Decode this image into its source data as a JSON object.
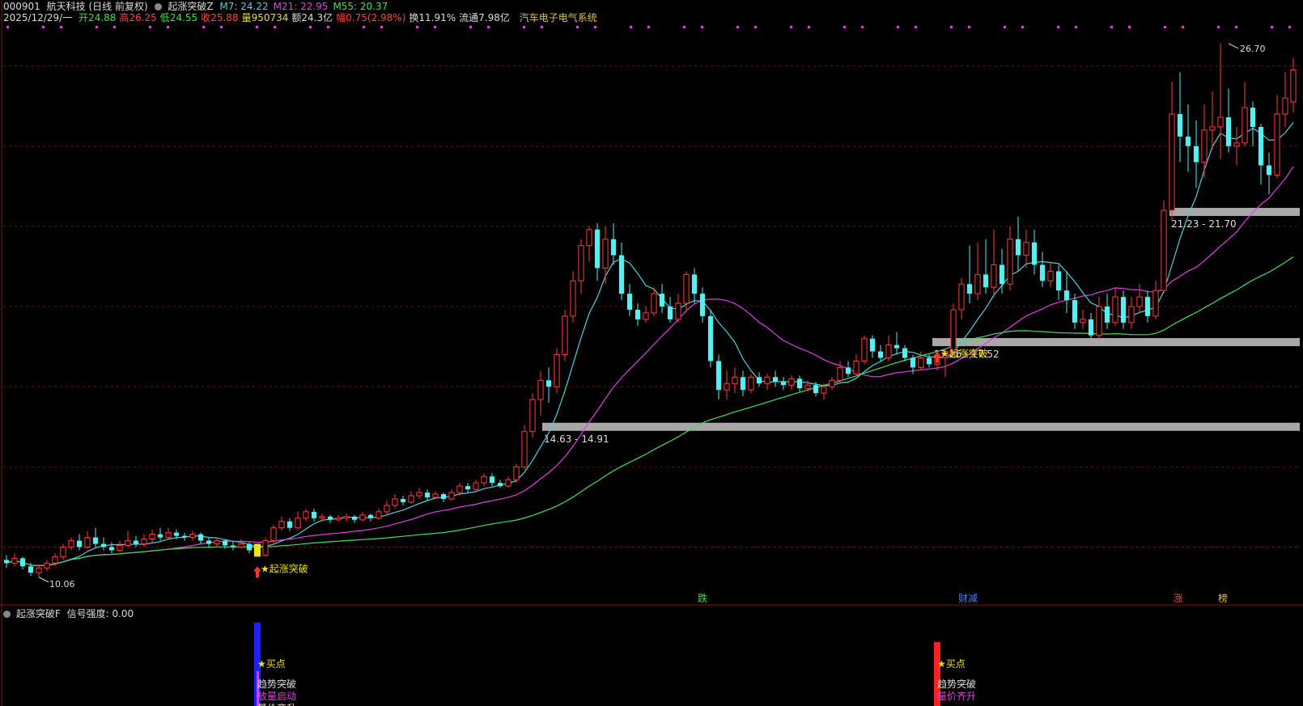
{
  "header": {
    "code": "000901",
    "name": "航天科技",
    "period": "(日线 前复权)",
    "indicator": "起涨突破Z",
    "ma": [
      {
        "label": "M7:",
        "value": "24.22",
        "color": "#4fd0e0"
      },
      {
        "label": "M21:",
        "value": "22.95",
        "color": "#e040e0"
      },
      {
        "label": "M55:",
        "value": "20.37",
        "color": "#40e060"
      }
    ],
    "date": "2025/12/29/一",
    "fields": [
      {
        "label": "开",
        "value": "24.88",
        "color": "#40e040"
      },
      {
        "label": "高",
        "value": "26.25",
        "color": "#ff4040"
      },
      {
        "label": "低",
        "value": "24.55",
        "color": "#40e040"
      },
      {
        "label": "收",
        "value": "25.88",
        "color": "#ff4040"
      },
      {
        "label": "量",
        "value": "950734",
        "color": "#e0e040"
      },
      {
        "label": "额",
        "value": "24.3亿",
        "color": "#dddddd"
      },
      {
        "label": "幅",
        "value": "0.75(2.98%)",
        "color": "#ff4040"
      },
      {
        "label": "换",
        "value": "11.91%",
        "color": "#dddddd"
      },
      {
        "label": "流通",
        "value": "7.98亿",
        "color": "#dddddd"
      }
    ],
    "sector": "汽车电子电气系统"
  },
  "colors": {
    "up": "#ff3d3d",
    "down": "#52f0f0",
    "ma7": "#4fd0e0",
    "ma21": "#e040e0",
    "ma55": "#40e060",
    "grid": "#6a1010",
    "zone": "#a8a8a8",
    "signal": "#f0e020"
  },
  "labels": {
    "high_price": "26.70",
    "low_price": "10.06",
    "breakout": "★起涨突破"
  },
  "zones": [
    {
      "range": "14.63 - 14.91",
      "price": 14.75
    },
    {
      "range": "17.26 - 17.52",
      "price": 17.39
    },
    {
      "range": "21.23 - 21.70",
      "price": 21.45
    }
  ],
  "events": [
    "跌",
    "财减",
    "涨",
    "榜"
  ],
  "sub": {
    "title": "起涨突破F",
    "strength_label": "信号强度:",
    "strength_value": "0.00",
    "signal1": {
      "buy": "★买点",
      "lines": [
        "趋势突破",
        "放量启动",
        "量价齐升"
      ]
    },
    "signal2": {
      "buy": "★买点",
      "lines": [
        "趋势突破",
        "量价齐升"
      ]
    }
  },
  "chart_data": {
    "type": "candlestick",
    "candles": [
      [
        10.6,
        10.5,
        10.75,
        10.35
      ],
      [
        10.5,
        10.65,
        10.8,
        10.4
      ],
      [
        10.65,
        10.4,
        10.7,
        10.3
      ],
      [
        10.4,
        10.2,
        10.5,
        10.1
      ],
      [
        10.2,
        10.35,
        10.45,
        10.06
      ],
      [
        10.35,
        10.5,
        10.6,
        10.25
      ],
      [
        10.5,
        10.7,
        10.8,
        10.4
      ],
      [
        10.7,
        11.0,
        11.1,
        10.6
      ],
      [
        11.0,
        11.2,
        11.3,
        10.9
      ],
      [
        11.2,
        11.0,
        11.4,
        10.9
      ],
      [
        11.0,
        11.3,
        11.5,
        10.95
      ],
      [
        11.3,
        11.1,
        11.6,
        11.0
      ],
      [
        11.1,
        11.0,
        11.3,
        10.9
      ],
      [
        11.0,
        10.9,
        11.15,
        10.8
      ],
      [
        10.9,
        11.05,
        11.2,
        10.85
      ],
      [
        11.05,
        11.2,
        11.5,
        11.0
      ],
      [
        11.2,
        11.1,
        11.35,
        11.0
      ],
      [
        11.1,
        11.25,
        11.4,
        11.0
      ],
      [
        11.25,
        11.4,
        11.55,
        11.1
      ],
      [
        11.4,
        11.3,
        11.6,
        11.2
      ],
      [
        11.3,
        11.45,
        11.6,
        11.25
      ],
      [
        11.45,
        11.35,
        11.55,
        11.25
      ],
      [
        11.35,
        11.3,
        11.45,
        11.2
      ],
      [
        11.3,
        11.4,
        11.5,
        11.2
      ],
      [
        11.4,
        11.2,
        11.45,
        11.1
      ],
      [
        11.2,
        11.1,
        11.3,
        11.0
      ],
      [
        11.1,
        11.2,
        11.3,
        11.0
      ],
      [
        11.2,
        11.05,
        11.25,
        10.95
      ],
      [
        11.05,
        11.0,
        11.2,
        10.9
      ],
      [
        11.0,
        11.1,
        11.25,
        10.95
      ],
      [
        11.1,
        10.9,
        11.15,
        10.8
      ],
      [
        10.9,
        10.75,
        11.0,
        10.7
      ],
      [
        10.75,
        11.2,
        11.3,
        10.7
      ],
      [
        11.2,
        11.6,
        11.7,
        11.1
      ],
      [
        11.6,
        11.8,
        11.95,
        11.5
      ],
      [
        11.8,
        11.6,
        11.9,
        11.5
      ],
      [
        11.6,
        11.9,
        12.1,
        11.55
      ],
      [
        11.9,
        12.1,
        12.2,
        11.8
      ],
      [
        12.1,
        11.9,
        12.2,
        11.8
      ],
      [
        11.9,
        11.95,
        12.05,
        11.8
      ],
      [
        11.95,
        11.85,
        12.0,
        11.75
      ],
      [
        11.85,
        11.9,
        12.0,
        11.8
      ],
      [
        11.9,
        11.95,
        12.05,
        11.8
      ],
      [
        11.95,
        11.85,
        12.0,
        11.75
      ],
      [
        11.85,
        12.0,
        12.1,
        11.8
      ],
      [
        12.0,
        11.9,
        12.05,
        11.8
      ],
      [
        11.9,
        12.1,
        12.2,
        11.85
      ],
      [
        12.1,
        12.3,
        12.45,
        12.0
      ],
      [
        12.3,
        12.5,
        12.65,
        12.2
      ],
      [
        12.5,
        12.4,
        12.6,
        12.3
      ],
      [
        12.4,
        12.6,
        12.75,
        12.35
      ],
      [
        12.6,
        12.7,
        12.85,
        12.5
      ],
      [
        12.7,
        12.55,
        12.8,
        12.45
      ],
      [
        12.55,
        12.65,
        12.75,
        12.5
      ],
      [
        12.65,
        12.5,
        12.7,
        12.4
      ],
      [
        12.5,
        12.7,
        12.8,
        12.45
      ],
      [
        12.7,
        12.9,
        13.0,
        12.6
      ],
      [
        12.9,
        12.8,
        13.0,
        12.7
      ],
      [
        12.8,
        13.0,
        13.1,
        12.7
      ],
      [
        13.0,
        13.2,
        13.3,
        12.9
      ],
      [
        13.2,
        13.0,
        13.3,
        12.9
      ],
      [
        13.0,
        12.9,
        13.1,
        12.85
      ],
      [
        12.9,
        13.1,
        13.2,
        12.85
      ],
      [
        13.1,
        13.5,
        13.6,
        13.0
      ],
      [
        13.5,
        14.6,
        14.8,
        13.4
      ],
      [
        14.6,
        15.6,
        15.8,
        14.4
      ],
      [
        15.6,
        16.2,
        16.5,
        15.1
      ],
      [
        16.2,
        16.0,
        16.6,
        15.5
      ],
      [
        16.0,
        17.0,
        17.2,
        15.8
      ],
      [
        17.0,
        18.2,
        18.4,
        16.8
      ],
      [
        18.2,
        19.3,
        19.6,
        18.0
      ],
      [
        19.3,
        20.4,
        20.6,
        18.9
      ],
      [
        20.4,
        20.9,
        21.0,
        19.9
      ],
      [
        20.9,
        19.7,
        21.1,
        19.3
      ],
      [
        19.7,
        20.6,
        21.0,
        19.2
      ],
      [
        20.6,
        20.1,
        21.1,
        19.8
      ],
      [
        20.1,
        18.9,
        20.5,
        18.7
      ],
      [
        18.9,
        18.4,
        19.2,
        18.2
      ],
      [
        18.4,
        18.1,
        18.6,
        17.9
      ],
      [
        18.1,
        18.3,
        18.5,
        18.0
      ],
      [
        18.3,
        18.9,
        19.1,
        18.2
      ],
      [
        18.9,
        18.5,
        19.2,
        18.3
      ],
      [
        18.5,
        18.1,
        18.8,
        18.0
      ],
      [
        18.1,
        18.6,
        18.9,
        18.0
      ],
      [
        18.6,
        19.5,
        19.6,
        18.3
      ],
      [
        19.5,
        18.9,
        19.7,
        18.6
      ],
      [
        18.9,
        18.2,
        19.1,
        18.0
      ],
      [
        18.2,
        16.8,
        18.4,
        16.6
      ],
      [
        16.8,
        15.9,
        17.0,
        15.6
      ],
      [
        15.9,
        16.1,
        16.5,
        15.6
      ],
      [
        16.1,
        16.3,
        16.6,
        15.8
      ],
      [
        16.3,
        15.9,
        16.5,
        15.7
      ],
      [
        15.9,
        16.3,
        16.4,
        15.8
      ],
      [
        16.3,
        16.1,
        16.45,
        16.0
      ],
      [
        16.1,
        16.3,
        16.4,
        15.9
      ],
      [
        16.3,
        16.15,
        16.5,
        16.0
      ],
      [
        16.15,
        16.05,
        16.3,
        15.9
      ],
      [
        16.05,
        16.25,
        16.35,
        15.9
      ],
      [
        16.25,
        15.95,
        16.35,
        15.85
      ],
      [
        15.95,
        16.05,
        16.2,
        15.85
      ],
      [
        16.05,
        15.8,
        16.15,
        15.7
      ],
      [
        15.8,
        16.0,
        16.1,
        15.6
      ],
      [
        16.0,
        16.2,
        16.3,
        15.9
      ],
      [
        16.2,
        16.6,
        16.8,
        16.1
      ],
      [
        16.6,
        16.4,
        16.8,
        16.3
      ],
      [
        16.4,
        16.8,
        17.0,
        16.35
      ],
      [
        16.8,
        17.5,
        17.6,
        16.7
      ],
      [
        17.5,
        17.1,
        17.6,
        16.9
      ],
      [
        17.1,
        16.9,
        17.3,
        16.8
      ],
      [
        16.9,
        17.3,
        17.6,
        16.8
      ],
      [
        17.3,
        17.2,
        17.7,
        17.0
      ],
      [
        17.2,
        16.9,
        17.3,
        16.8
      ],
      [
        16.9,
        16.6,
        17.0,
        16.4
      ],
      [
        16.6,
        16.9,
        17.1,
        16.5
      ],
      [
        16.9,
        16.7,
        17.0,
        16.6
      ],
      [
        16.7,
        16.9,
        17.1,
        16.5
      ],
      [
        16.9,
        17.1,
        17.2,
        16.3
      ],
      [
        17.1,
        18.4,
        18.6,
        16.9
      ],
      [
        18.4,
        19.2,
        19.4,
        18.1
      ],
      [
        19.2,
        18.9,
        20.4,
        18.6
      ],
      [
        18.9,
        19.5,
        20.5,
        18.7
      ],
      [
        19.5,
        19.1,
        20.6,
        18.9
      ],
      [
        19.1,
        19.8,
        20.9,
        18.8
      ],
      [
        19.8,
        19.2,
        20.3,
        18.9
      ],
      [
        19.2,
        20.6,
        21.0,
        19.0
      ],
      [
        20.6,
        20.1,
        21.3,
        19.6
      ],
      [
        20.1,
        20.5,
        20.9,
        19.7
      ],
      [
        20.5,
        19.8,
        20.9,
        19.5
      ],
      [
        19.8,
        19.3,
        20.2,
        19.1
      ],
      [
        19.3,
        19.6,
        19.9,
        19.1
      ],
      [
        19.6,
        19.0,
        19.8,
        18.7
      ],
      [
        19.0,
        18.7,
        19.6,
        18.3
      ],
      [
        18.7,
        18.0,
        18.9,
        17.8
      ],
      [
        18.0,
        18.1,
        18.4,
        17.8
      ],
      [
        18.1,
        17.6,
        18.3,
        17.5
      ],
      [
        17.6,
        18.5,
        18.8,
        17.5
      ],
      [
        18.5,
        18.0,
        18.9,
        17.8
      ],
      [
        18.0,
        18.8,
        19.1,
        17.9
      ],
      [
        18.8,
        18.0,
        19.0,
        17.8
      ],
      [
        18.0,
        18.5,
        18.8,
        17.8
      ],
      [
        18.5,
        18.8,
        19.2,
        18.3
      ],
      [
        18.8,
        18.2,
        19.0,
        18.0
      ],
      [
        18.2,
        19.0,
        19.3,
        18.1
      ],
      [
        19.0,
        21.5,
        21.8,
        18.9
      ],
      [
        21.5,
        24.5,
        25.5,
        21.2
      ],
      [
        24.5,
        23.8,
        25.8,
        23.0
      ],
      [
        23.8,
        23.5,
        24.8,
        22.7
      ],
      [
        23.5,
        23.0,
        24.3,
        22.2
      ],
      [
        23.0,
        24.0,
        24.8,
        22.5
      ],
      [
        24.0,
        24.1,
        25.2,
        23.4
      ],
      [
        24.1,
        24.4,
        26.7,
        23.1
      ],
      [
        24.4,
        23.5,
        25.3,
        23.3
      ],
      [
        23.5,
        23.6,
        24.1,
        22.9
      ],
      [
        23.6,
        24.7,
        25.5,
        23.5
      ],
      [
        24.7,
        24.1,
        24.9,
        23.5
      ],
      [
        24.1,
        22.9,
        24.2,
        22.3
      ],
      [
        22.9,
        22.6,
        23.3,
        22.0
      ],
      [
        22.6,
        24.5,
        25.1,
        22.5
      ],
      [
        24.5,
        25.0,
        25.8,
        24.1
      ],
      [
        24.88,
        25.88,
        26.25,
        24.55
      ]
    ]
  }
}
